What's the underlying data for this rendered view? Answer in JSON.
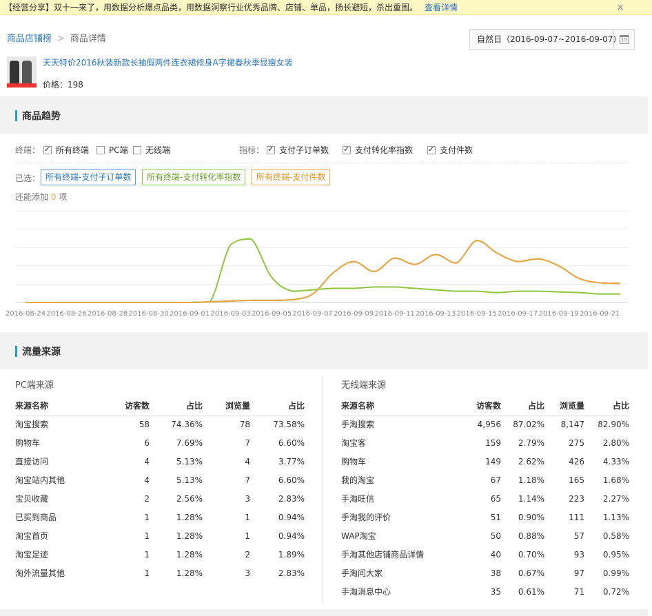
{
  "notice": {
    "text": "【经营分享】双十一来了，用数据分析爆点品类，用数据洞察行业优秀品牌、店铺、单品，扬长避短，杀出重围。",
    "link": "查看详情",
    "close": "×"
  },
  "breadcrumb": {
    "item1": "商品店铺榜",
    "sep": ">",
    "item2": "商品详情"
  },
  "date_range": "自然日（2016-09-07~2016-09-07）",
  "calendar_icon_text": "15",
  "product": {
    "title": "天天特价2016秋装新款长袖假两件连衣裙修身A字裙春秋季显瘦女装",
    "price": "价格：198"
  },
  "trend": {
    "title": "商品趋势",
    "terminal_label": "终端：",
    "terminals": [
      {
        "label": "所有终端",
        "checked": true
      },
      {
        "label": "PC端",
        "checked": false
      },
      {
        "label": "无线端",
        "checked": false
      }
    ],
    "metric_label": "指标：",
    "metrics": [
      {
        "label": "支付子订单数",
        "checked": true
      },
      {
        "label": "支付转化率指数",
        "checked": true
      },
      {
        "label": "支付件数",
        "checked": true
      }
    ],
    "selected_label": "已选：",
    "chips": [
      "所有终端-支付子订单数",
      "所有终端-支付转化率指数",
      "所有终端-支付件数"
    ],
    "add_prefix": "还能添加",
    "add_count": "0",
    "add_suffix": "项"
  },
  "chart_data": {
    "type": "line",
    "x_tick_labels": [
      "2016-08-24",
      "2016-08-26",
      "2016-08-28",
      "2016-08-30",
      "2016-09-01",
      "2016-09-03",
      "2016-09-05",
      "2016-09-07",
      "2016-09-09",
      "2016-09-11",
      "2016-09-13",
      "2016-09-15",
      "2016-09-17",
      "2016-09-19",
      "2016-09-21"
    ],
    "x": [
      "2016-08-24",
      "2016-08-25",
      "2016-08-26",
      "2016-08-27",
      "2016-08-28",
      "2016-08-29",
      "2016-08-30",
      "2016-08-31",
      "2016-09-01",
      "2016-09-02",
      "2016-09-03",
      "2016-09-04",
      "2016-09-05",
      "2016-09-06",
      "2016-09-07",
      "2016-09-08",
      "2016-09-09",
      "2016-09-10",
      "2016-09-11",
      "2016-09-12",
      "2016-09-13",
      "2016-09-14",
      "2016-09-15",
      "2016-09-16",
      "2016-09-17",
      "2016-09-18",
      "2016-09-19",
      "2016-09-20",
      "2016-09-21",
      "2016-09-22"
    ],
    "ylim": [
      0,
      130
    ],
    "grid": true,
    "series": [
      {
        "color": "#3a7fc0",
        "values": [
          0,
          0,
          0,
          0,
          0,
          0,
          0,
          0,
          0,
          1,
          2,
          3,
          3,
          4,
          12,
          42,
          58,
          44,
          63,
          54,
          68,
          56,
          88,
          70,
          58,
          62,
          52,
          34,
          28,
          27
        ]
      },
      {
        "color": "#8dc63f",
        "values": [
          0,
          0,
          0,
          0,
          0,
          0,
          0,
          0,
          0,
          1,
          82,
          90,
          36,
          16,
          18,
          20,
          20,
          22,
          22,
          20,
          18,
          16,
          16,
          14,
          16,
          16,
          15,
          14,
          12,
          12
        ]
      },
      {
        "color": "#f0a73b",
        "values": [
          0,
          0,
          0,
          0,
          0,
          0,
          0,
          0,
          0,
          1,
          2,
          3,
          3,
          4,
          12,
          42,
          58,
          44,
          63,
          54,
          68,
          56,
          88,
          70,
          58,
          62,
          52,
          34,
          28,
          27
        ]
      }
    ]
  },
  "traffic": {
    "title": "流量来源",
    "pc": {
      "heading": "PC端来源",
      "columns": [
        "来源名称",
        "访客数",
        "占比",
        "浏览量",
        "占比"
      ],
      "rows": [
        [
          "淘宝搜索",
          "58",
          "74.36%",
          "78",
          "73.58%"
        ],
        [
          "购物车",
          "6",
          "7.69%",
          "7",
          "6.60%"
        ],
        [
          "直接访问",
          "4",
          "5.13%",
          "4",
          "3.77%"
        ],
        [
          "淘宝站内其他",
          "4",
          "5.13%",
          "7",
          "6.60%"
        ],
        [
          "宝贝收藏",
          "2",
          "2.56%",
          "3",
          "2.83%"
        ],
        [
          "已买到商品",
          "1",
          "1.28%",
          "1",
          "0.94%"
        ],
        [
          "淘宝首页",
          "1",
          "1.28%",
          "1",
          "0.94%"
        ],
        [
          "淘宝足迹",
          "1",
          "1.28%",
          "2",
          "1.89%"
        ],
        [
          "淘外流量其他",
          "1",
          "1.28%",
          "3",
          "2.83%"
        ]
      ]
    },
    "mobile": {
      "heading": "无线端来源",
      "columns": [
        "来源名称",
        "访客数",
        "占比",
        "浏览量",
        "占比"
      ],
      "rows": [
        [
          "手淘搜索",
          "4,956",
          "87.02%",
          "8,147",
          "82.90%"
        ],
        [
          "淘宝客",
          "159",
          "2.79%",
          "275",
          "2.80%"
        ],
        [
          "购物车",
          "149",
          "2.62%",
          "426",
          "4.33%"
        ],
        [
          "我的淘宝",
          "67",
          "1.18%",
          "165",
          "1.68%"
        ],
        [
          "手淘旺信",
          "65",
          "1.14%",
          "223",
          "2.27%"
        ],
        [
          "手淘我的评价",
          "51",
          "0.90%",
          "111",
          "1.13%"
        ],
        [
          "WAP淘宝",
          "50",
          "0.88%",
          "57",
          "0.58%"
        ],
        [
          "手淘其他店铺商品详情",
          "40",
          "0.70%",
          "93",
          "0.95%"
        ],
        [
          "手淘问大家",
          "38",
          "0.67%",
          "97",
          "0.99%"
        ],
        [
          "手淘消息中心",
          "35",
          "0.61%",
          "71",
          "0.72%"
        ]
      ]
    }
  }
}
